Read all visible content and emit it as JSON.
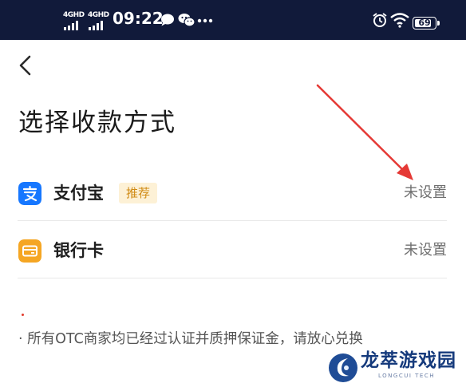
{
  "status_bar": {
    "sim1": "4GHD",
    "sim2": "4GHD",
    "time": "09:22",
    "battery": "69",
    "icons": [
      "chat-bubble-icon",
      "wechat-icon",
      "more-dots-icon",
      "alarm-icon",
      "wifi-icon",
      "battery-icon"
    ]
  },
  "header": {
    "back_icon": "chevron-left-icon"
  },
  "page": {
    "title": "选择收款方式"
  },
  "methods": [
    {
      "name": "支付宝",
      "badge": "推荐",
      "status": "未设置",
      "icon": "alipay-icon",
      "color": "#1677ff"
    },
    {
      "name": "银行卡",
      "status": "未设置",
      "icon": "bank-card-icon",
      "color": "#f5a623"
    }
  ],
  "notice": "· 所有OTC商家均已经过认证并质押保证金，请放心兑换",
  "annotation": {
    "color": "#e53935"
  },
  "watermark": {
    "title": "龙萃游戏园",
    "subtitle": "LONGCUI TECH"
  }
}
